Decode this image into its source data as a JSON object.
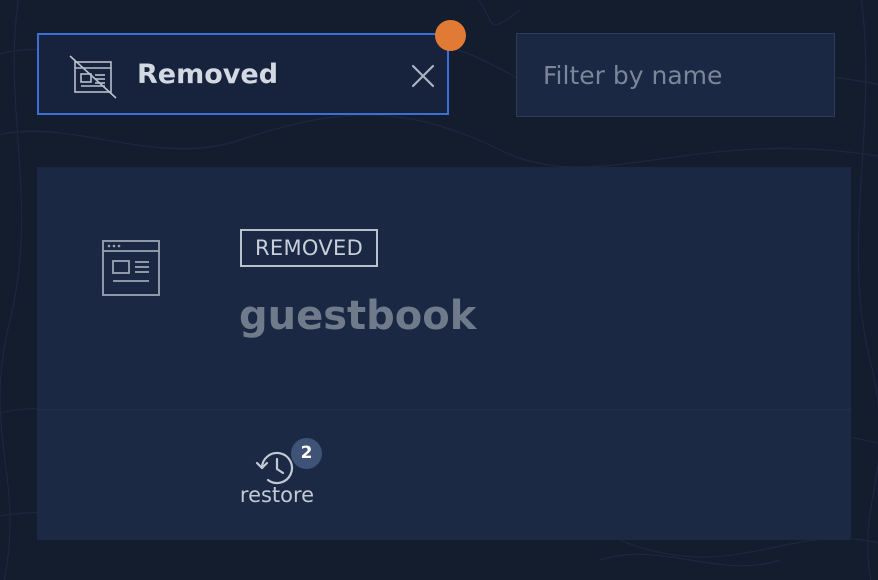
{
  "filter_chip": {
    "label": "Removed",
    "icon": "removed-app-icon",
    "close_icon": "close-icon",
    "notification_dot_color": "#e07a35"
  },
  "search": {
    "placeholder": "Filter by name",
    "value": ""
  },
  "card": {
    "status": "REMOVED",
    "name": "guestbook",
    "icon": "web-app-icon",
    "actions": {
      "restore": {
        "label": "restore",
        "count": "2",
        "icon": "restore-history-icon"
      }
    }
  },
  "colors": {
    "background": "#141d2e",
    "panel": "#1a2844",
    "accent_border": "#3a6fd8",
    "badge": "#3f5377"
  }
}
